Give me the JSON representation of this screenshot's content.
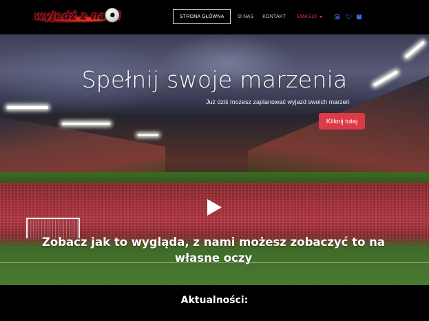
{
  "logo": {
    "text": "wyjedź z nami"
  },
  "nav": {
    "items": [
      {
        "label": "STRONA GŁÓWNA"
      },
      {
        "label": "O NAS"
      },
      {
        "label": "KONTAKT"
      },
      {
        "label": "EMAS10"
      }
    ],
    "social": [
      "instagram-icon",
      "twitter-icon",
      "facebook-icon"
    ]
  },
  "hero": {
    "title": "Spełnij swoje marzenia",
    "subtitle": "Już dziś możesz zaplanować wyjazd swoich marzeń",
    "button_label": "Kliknij tutaj"
  },
  "video": {
    "caption": "Zobacz jak to wygląda, z nami możesz zobaczyć to na własne oczy"
  },
  "news": {
    "title": "Aktualności:"
  },
  "colors": {
    "accent": "#dd3a48",
    "social": "#3d6fe0",
    "background": "#000000"
  }
}
